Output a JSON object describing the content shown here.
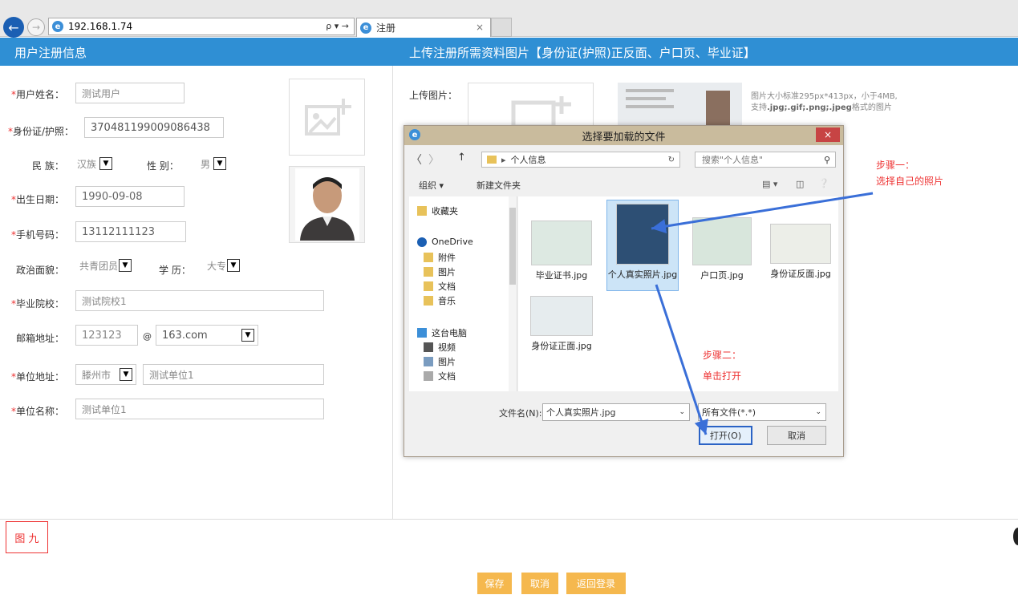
{
  "browser": {
    "address": "192.168.1.74",
    "tab_title": "注册",
    "address_tools": "ρ ▾ →",
    "tab_close": "×"
  },
  "header": {
    "left_title": "用户注册信息",
    "right_title": "上传注册所需资料图片【身份证(护照)正反面、户口页、毕业证】"
  },
  "form": {
    "name_label": "用户姓名：",
    "name_value": "测试用户",
    "id_label": "身份证/护照：",
    "id_value": "370481199009086438",
    "ethnic_label": "民 族：",
    "ethnic_value": "汉族",
    "gender_label": "性 别：",
    "gender_value": "男",
    "birth_label": "出生日期：",
    "birth_value": "1990-09-08",
    "phone_label": "手机号码：",
    "phone_value": "13112111123",
    "political_label": "政治面貌：",
    "political_value": "共青团员",
    "edu_label": "学 历：",
    "edu_value": "大专",
    "school_label": "毕业院校：",
    "school_value": "测试院校1",
    "email_label": "邮箱地址：",
    "email_user": "123123",
    "email_at": "@",
    "email_domain": "163.com",
    "workaddr_label": "单位地址：",
    "workaddr_city": "滕州市",
    "workaddr_value": "测试单位1",
    "workname_label": "单位名称：",
    "workname_value": "测试单位1",
    "required_mark": "*"
  },
  "upload": {
    "label": "上传图片：",
    "hint_line1": "图片大小标准295px*413px，小于4MB,",
    "hint_line2_prefix": "支持",
    "hint_formats": ".jpg;.gif;.png;.jpeg",
    "hint_line2_suffix": "格式的图片"
  },
  "dialog": {
    "title": "选择要加载的文件",
    "close": "×",
    "path_root": "个人信息",
    "search_placeholder": "搜索\"个人信息\"",
    "organize": "组织 ▾",
    "new_folder": "新建文件夹",
    "sidebar": [
      {
        "label": "收藏夹"
      },
      {
        "label": "OneDrive"
      },
      {
        "label": "附件"
      },
      {
        "label": "图片"
      },
      {
        "label": "文档"
      },
      {
        "label": "音乐"
      },
      {
        "label": "这台电脑"
      },
      {
        "label": "视频"
      },
      {
        "label": "图片"
      },
      {
        "label": "文档"
      }
    ],
    "files": [
      {
        "name": "毕业证书.jpg"
      },
      {
        "name": "个人真实照片.jpg"
      },
      {
        "name": "户口页.jpg"
      },
      {
        "name": "身份证反面.jpg"
      },
      {
        "name": "身份证正面.jpg"
      }
    ],
    "filename_label": "文件名(N):",
    "filename_value": "个人真实照片.jpg",
    "filetype_value": "所有文件(*.*)",
    "open_button": "打开(O)",
    "cancel_button": "取消"
  },
  "annotations": {
    "step1_title": "步骤一：",
    "step1_text": "选择自己的照片",
    "step2_title": "步骤二：",
    "step2_text": "单击打开",
    "arrow_color": "#3a6fd8"
  },
  "footer": {
    "figure_label": "图 九",
    "save": "保存",
    "cancel": "取消",
    "back": "返回登录"
  },
  "colors": {
    "header": "#2f8fd4",
    "required": "#e33333",
    "footer_button": "#f5b84e"
  }
}
